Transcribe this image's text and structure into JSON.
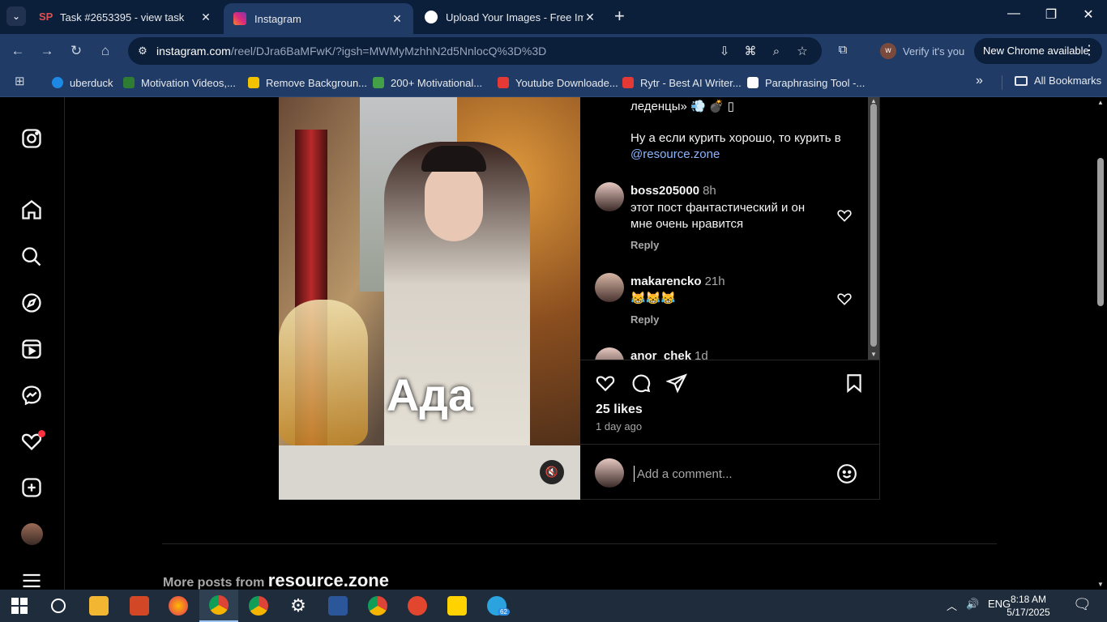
{
  "browser": {
    "tabs": [
      {
        "title": "Task #2653395 - view task",
        "favicon_color": "#d03b3b"
      },
      {
        "title": "Instagram",
        "favicon_color": "#d6249f"
      },
      {
        "title": "Upload Your Images - Free Imag",
        "favicon_color": "#ffffff"
      }
    ],
    "url_host": "instagram.com",
    "url_path": "/reel/DJra6BaMFwK/?igsh=MWMyMzhhN2d5NnlocQ%3D%3D",
    "verify_label": "Verify it's you",
    "new_chrome_label": "New Chrome available",
    "bookmarks": [
      {
        "label": "uberduck",
        "color": "#1e88e5"
      },
      {
        "label": "Motivation Videos,...",
        "color": "#2e7d32"
      },
      {
        "label": "Remove Backgroun...",
        "color": "#f2c200"
      },
      {
        "label": "200+ Motivational...",
        "color": "#43a047"
      },
      {
        "label": "Youtube Downloade...",
        "color": "#e53935"
      },
      {
        "label": "Rytr - Best AI Writer...",
        "color": "#e53935"
      },
      {
        "label": "Paraphrasing Tool -...",
        "color": "#ffffff"
      }
    ],
    "all_bookmarks_label": "All Bookmarks"
  },
  "post": {
    "caption_line1": "леденцы» 💨 💣 ▯",
    "caption_line2": "Ну а если курить хорошо, то курить в",
    "caption_mention": "@resource.zone",
    "video_caption": "Ада",
    "comments": [
      {
        "user": "boss205000",
        "time": "8h",
        "text": "этот пост фантастический и он мне очень нравится",
        "reply": "Reply"
      },
      {
        "user": "makarencko",
        "time": "21h",
        "text": "😹😹😹",
        "reply": "Reply"
      },
      {
        "user": "anor_chek",
        "time": "1d",
        "text": "",
        "reply": ""
      }
    ],
    "likes": "25 likes",
    "posted": "1 day ago",
    "comment_placeholder": "Add a comment..."
  },
  "more_posts": {
    "prefix": "More posts from",
    "account": "resource.zone"
  },
  "taskbar": {
    "lang": "ENG",
    "time": "8:18 AM",
    "date": "5/17/2025",
    "telegram_badge": "62"
  }
}
